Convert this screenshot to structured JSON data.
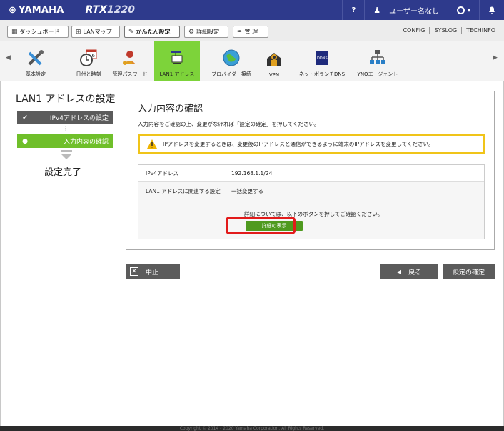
{
  "brand": {
    "logo": "YAMAHA",
    "model_prefix": "RTX",
    "model_number": "1220"
  },
  "topbar": {
    "help": "?",
    "user": "ユーザー名なし",
    "status": "○▾",
    "bell": "🔔"
  },
  "tabs": [
    {
      "label": "ダッシュボード"
    },
    {
      "label": "LANマップ"
    },
    {
      "label": "かんたん設定"
    },
    {
      "label": "詳細設定"
    },
    {
      "label": "管 理"
    }
  ],
  "links": [
    "CONFIG",
    "SYSLOG",
    "TECHINFO"
  ],
  "toolbar": [
    {
      "label": "基本設定",
      "icon": "tools-icon"
    },
    {
      "label": "日付と時刻",
      "icon": "calendar-clock-icon"
    },
    {
      "label": "管理パスワード",
      "icon": "user-key-icon"
    },
    {
      "label": "LAN1 アドレス",
      "icon": "network-pc-icon",
      "active": true
    },
    {
      "label": "プロバイダー接続",
      "icon": "globe-icon"
    },
    {
      "label": "VPN",
      "icon": "vpn-icon"
    },
    {
      "label": "ネットボランチDNS",
      "icon": "ddns-icon"
    },
    {
      "label": "YNOエージェント",
      "icon": "yno-icon"
    }
  ],
  "wizard": {
    "title": "LAN1 アドレスの設定",
    "step1": {
      "mark": "✔",
      "label": "IPv4アドレスの設定"
    },
    "step2": {
      "mark": "●",
      "label": "入力内容の確認"
    },
    "dots": "⋮",
    "done": "設定完了"
  },
  "panel": {
    "title": "入力内容の確認",
    "description": "入力内容をご確認の上、変更がなければ「設定の確定」を押してください。",
    "warning": "IPアドレスを変更するときは、変更後のIPアドレスと通信ができるように端末のIPアドレスを変更してください。",
    "rows": [
      {
        "key": "IPv4アドレス",
        "value": "192.168.1.1/24"
      },
      {
        "key": "LAN1 アドレスに関連する設定",
        "value": "一括変更する"
      }
    ],
    "detail_text": "詳細については、以下のボタンを押してご確認ください。",
    "detail_button": "詳細の表示"
  },
  "buttons": {
    "cancel": "中止",
    "back": "戻る",
    "confirm": "設定の確定"
  },
  "footer": "Copyright © 2014 - 2020 Yamaha Corporation. All Rights Reserved."
}
